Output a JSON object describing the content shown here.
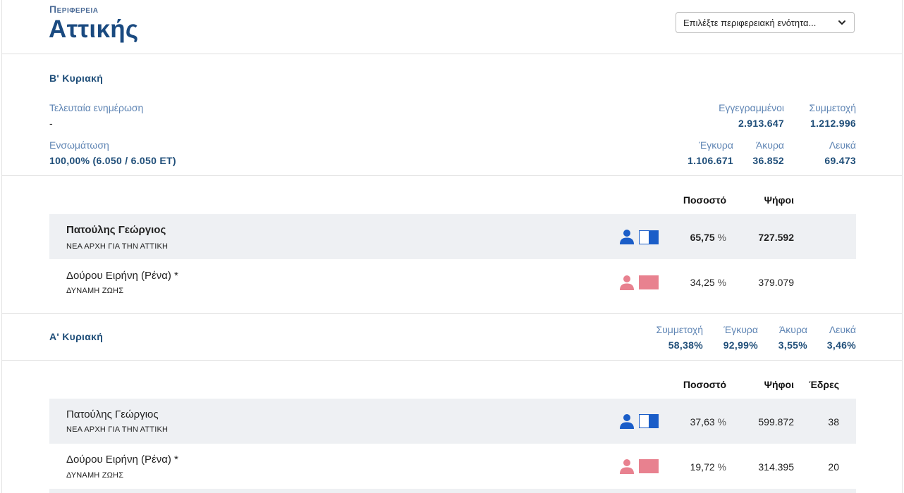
{
  "header": {
    "region_label": "Περιφερεια",
    "region_name": "Αττικής",
    "select_placeholder": "Επιλέξτε περιφερειακή ενότητα..."
  },
  "round_b": {
    "title": "Β' Κυριακή",
    "last_update_label": "Τελευταία ενημέρωση",
    "last_update_value": "-",
    "integration_label": "Ενσωμάτωση",
    "integration_value": "100,00% (6.050 / 6.050 ΕΤ)",
    "registered_label": "Εγγεγραμμένοι",
    "registered_value": "2.913.647",
    "turnout_label": "Συμμετοχή",
    "turnout_value": "1.212.996",
    "valid_label": "Έγκυρα",
    "valid_value": "1.106.671",
    "invalid_label": "Άκυρα",
    "invalid_value": "36.852",
    "blank_label": "Λευκά",
    "blank_value": "69.473",
    "col_percent": "Ποσοστό",
    "col_votes": "Ψήφοι",
    "candidates": [
      {
        "name": "Πατούλης Γεώργιος",
        "party": "ΝΕΑ ΑΡΧΗ ΓΙΑ ΤΗΝ ΑΤΤΙΚΗ",
        "percent": "65,75",
        "votes": "727.592",
        "color": "#1a5dc8"
      },
      {
        "name": "Δούρου Ειρήνη (Ρένα) *",
        "party": "ΔΥΝΑΜΗ ΖΩΗΣ",
        "percent": "34,25",
        "votes": "379.079",
        "color": "#e8818f"
      }
    ]
  },
  "round_a": {
    "title": "Α' Κυριακή",
    "turnout_label": "Συμμετοχή",
    "turnout_value": "58,38%",
    "valid_label": "Έγκυρα",
    "valid_value": "92,99%",
    "invalid_label": "Άκυρα",
    "invalid_value": "3,55%",
    "blank_label": "Λευκά",
    "blank_value": "3,46%",
    "col_percent": "Ποσοστό",
    "col_votes": "Ψήφοι",
    "col_seats": "Έδρες",
    "candidates": [
      {
        "name": "Πατούλης Γεώργιος",
        "party": "ΝΕΑ ΑΡΧΗ ΓΙΑ ΤΗΝ ΑΤΤΙΚΗ",
        "percent": "37,63",
        "votes": "599.872",
        "seats": "38",
        "color": "#1a5dc8"
      },
      {
        "name": "Δούρου Ειρήνη (Ρένα) *",
        "party": "ΔΥΝΑΜΗ ΖΩΗΣ",
        "percent": "19,72",
        "votes": "314.395",
        "seats": "20",
        "color": "#e8818f"
      }
    ]
  },
  "percent_symbol": "%"
}
